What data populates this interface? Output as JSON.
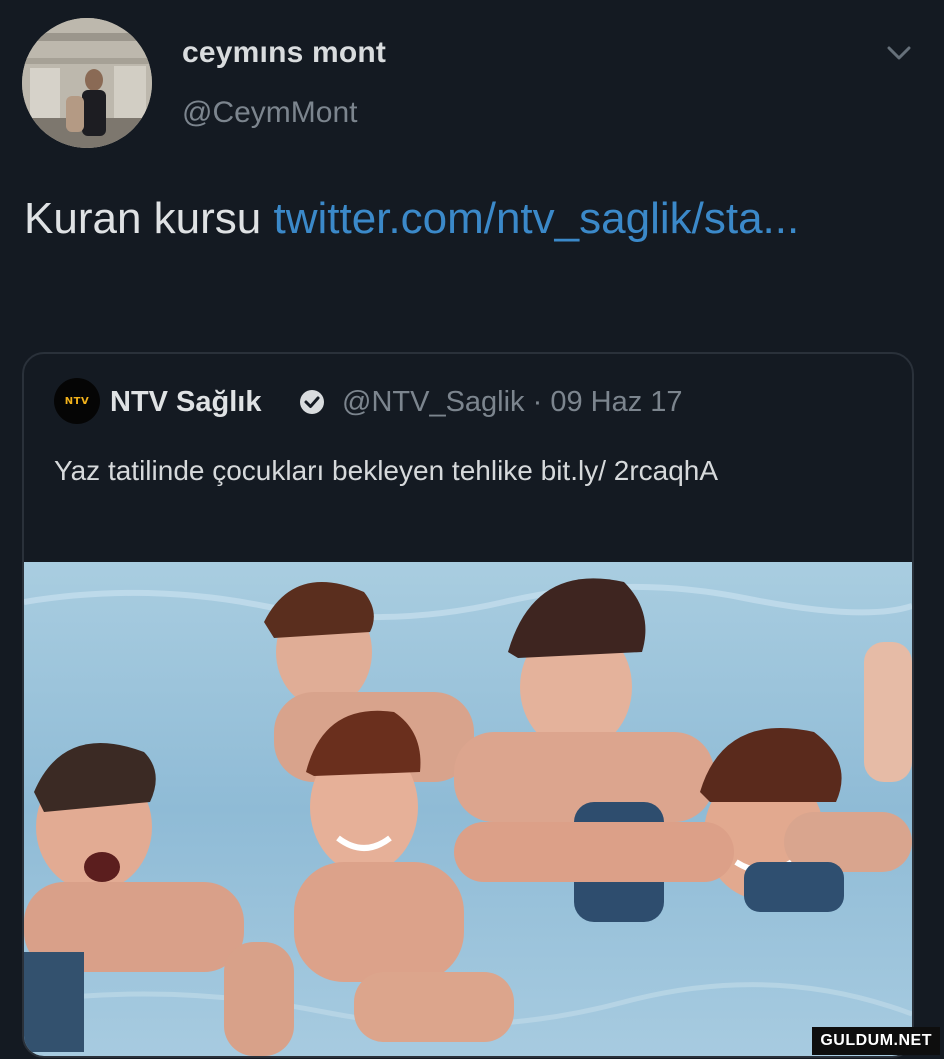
{
  "tweet": {
    "author": {
      "display_name": "ceymıns mont",
      "handle": "@CeymMont",
      "avatar_icon": "profile-photo"
    },
    "menu_icon": "chevron-down-icon",
    "text": "Kuran kursu ",
    "link_text": "twitter.com/ntv_saglik/sta..."
  },
  "quoted_tweet": {
    "logo_text": "NTV",
    "display_name": "NTV Sağlık",
    "verified_icon": "verified-badge-icon",
    "handle_date": "@NTV_Saglik · 09 Haz 17",
    "text": "Yaz tatilinde çocukları bekleyen tehlike bit.ly/ 2rcaqhA",
    "media_icon": "photo-children-swimming-underwater"
  },
  "watermark": "GULDUM.NET",
  "colors": {
    "background": "#141a22",
    "link": "#3b89c9",
    "secondary_text": "#7c858e",
    "border": "#2a313a"
  }
}
